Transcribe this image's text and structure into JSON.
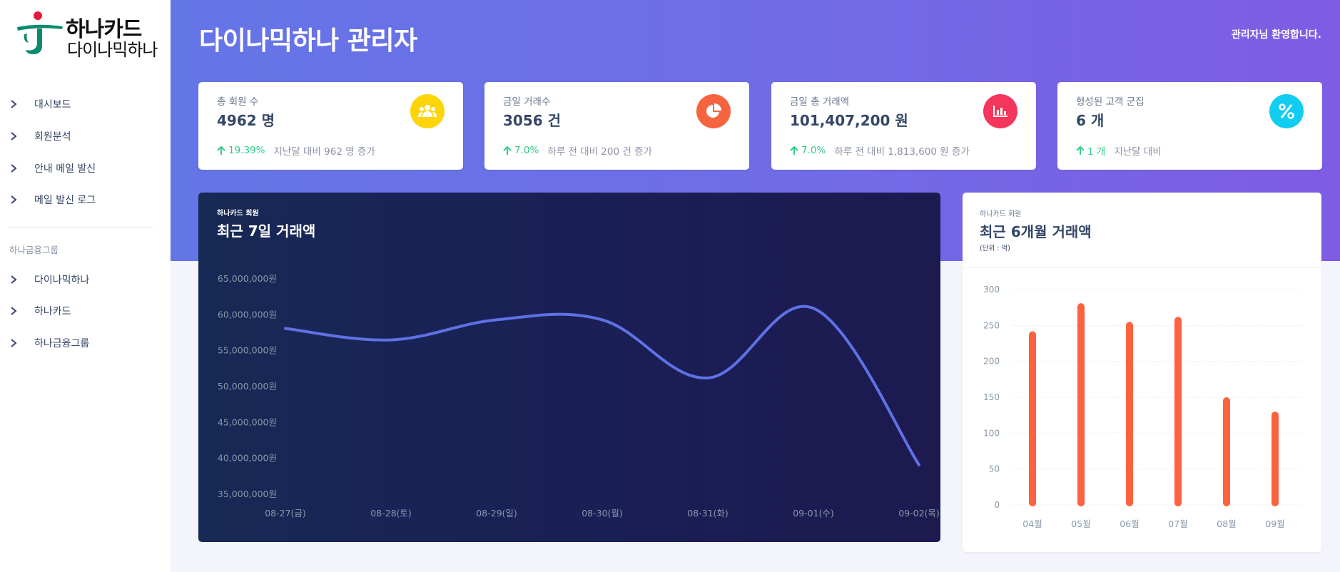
{
  "sidebar": {
    "logo_line1": "하나카드",
    "logo_line2": "다이나믹하나",
    "items": [
      {
        "label": "대시보드"
      },
      {
        "label": "회원분석"
      },
      {
        "label": "안내 메일 발신"
      },
      {
        "label": "메일 발신 로그"
      }
    ],
    "section_title": "하나금융그룹",
    "section_items": [
      {
        "label": "다이나믹하나"
      },
      {
        "label": "하나카드"
      },
      {
        "label": "하나금융그룹"
      }
    ]
  },
  "header": {
    "title": "다이나믹하나 관리자",
    "welcome": "관리자님 환영합니다."
  },
  "cards": [
    {
      "label": "총 회원 수",
      "value": "4962 명",
      "change": "19.39%",
      "note": "지난달 대비 962 명 증가",
      "icon": "users-icon",
      "color": "#fdd405"
    },
    {
      "label": "금일 거래수",
      "value": "3056 건",
      "change": "7.0%",
      "note": "하루 전 대비 200 건 증가",
      "icon": "pie-chart-icon",
      "color": "#f5643e"
    },
    {
      "label": "금일 총 거래액",
      "value": "101,407,200 원",
      "change": "7.0%",
      "note": "하루 전 대비 1,813,600 원 증가",
      "icon": "bar-chart-icon",
      "color": "#f5365c"
    },
    {
      "label": "형성된 고객 군집",
      "value": "6 개",
      "change": "1 개",
      "note": "지난달 대비",
      "icon": "percent-icon",
      "color": "#11cdef"
    }
  ],
  "colors": {
    "line": "#5e72e4",
    "bar": "#fb6340",
    "positive": "#2dce89"
  },
  "chart_data": [
    {
      "type": "line",
      "subtitle": "하나카드 회원",
      "title": "최근 7일 거래액",
      "x": [
        "08-27(금)",
        "08-28(토)",
        "08-29(일)",
        "08-30(월)",
        "08-31(화)",
        "09-01(수)",
        "09-02(목)"
      ],
      "values": [
        58000000,
        56400000,
        59200000,
        59200000,
        51100000,
        60800000,
        39000000
      ],
      "yticks": [
        "65,000,000원",
        "60,000,000원",
        "55,000,000원",
        "50,000,000원",
        "45,000,000원",
        "40,000,000원",
        "35,000,000원"
      ],
      "ylim": [
        35000000,
        65000000
      ],
      "grid": false
    },
    {
      "type": "bar",
      "subtitle": "하나카드 회원",
      "title": "최근 6개월 거래액",
      "unit": "(단위 : 억)",
      "categories": [
        "04월",
        "05월",
        "06월",
        "07월",
        "08월",
        "09월"
      ],
      "values": [
        242,
        281,
        255,
        262,
        150,
        130
      ],
      "yticks": [
        "300",
        "250",
        "200",
        "150",
        "100",
        "50",
        "0"
      ],
      "ylim": [
        0,
        300
      ],
      "grid": true
    }
  ]
}
